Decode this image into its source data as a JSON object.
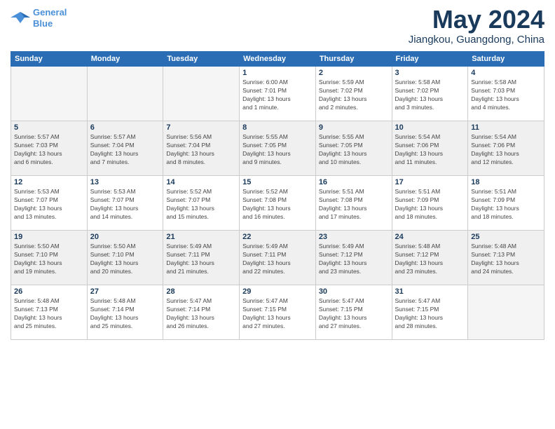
{
  "logo": {
    "line1": "General",
    "line2": "Blue"
  },
  "title": "May 2024",
  "location": "Jiangkou, Guangdong, China",
  "days_of_week": [
    "Sunday",
    "Monday",
    "Tuesday",
    "Wednesday",
    "Thursday",
    "Friday",
    "Saturday"
  ],
  "weeks": [
    [
      {
        "day": "",
        "info": ""
      },
      {
        "day": "",
        "info": ""
      },
      {
        "day": "",
        "info": ""
      },
      {
        "day": "1",
        "info": "Sunrise: 6:00 AM\nSunset: 7:01 PM\nDaylight: 13 hours\nand 1 minute."
      },
      {
        "day": "2",
        "info": "Sunrise: 5:59 AM\nSunset: 7:02 PM\nDaylight: 13 hours\nand 2 minutes."
      },
      {
        "day": "3",
        "info": "Sunrise: 5:58 AM\nSunset: 7:02 PM\nDaylight: 13 hours\nand 3 minutes."
      },
      {
        "day": "4",
        "info": "Sunrise: 5:58 AM\nSunset: 7:03 PM\nDaylight: 13 hours\nand 4 minutes."
      }
    ],
    [
      {
        "day": "5",
        "info": "Sunrise: 5:57 AM\nSunset: 7:03 PM\nDaylight: 13 hours\nand 6 minutes."
      },
      {
        "day": "6",
        "info": "Sunrise: 5:57 AM\nSunset: 7:04 PM\nDaylight: 13 hours\nand 7 minutes."
      },
      {
        "day": "7",
        "info": "Sunrise: 5:56 AM\nSunset: 7:04 PM\nDaylight: 13 hours\nand 8 minutes."
      },
      {
        "day": "8",
        "info": "Sunrise: 5:55 AM\nSunset: 7:05 PM\nDaylight: 13 hours\nand 9 minutes."
      },
      {
        "day": "9",
        "info": "Sunrise: 5:55 AM\nSunset: 7:05 PM\nDaylight: 13 hours\nand 10 minutes."
      },
      {
        "day": "10",
        "info": "Sunrise: 5:54 AM\nSunset: 7:06 PM\nDaylight: 13 hours\nand 11 minutes."
      },
      {
        "day": "11",
        "info": "Sunrise: 5:54 AM\nSunset: 7:06 PM\nDaylight: 13 hours\nand 12 minutes."
      }
    ],
    [
      {
        "day": "12",
        "info": "Sunrise: 5:53 AM\nSunset: 7:07 PM\nDaylight: 13 hours\nand 13 minutes."
      },
      {
        "day": "13",
        "info": "Sunrise: 5:53 AM\nSunset: 7:07 PM\nDaylight: 13 hours\nand 14 minutes."
      },
      {
        "day": "14",
        "info": "Sunrise: 5:52 AM\nSunset: 7:07 PM\nDaylight: 13 hours\nand 15 minutes."
      },
      {
        "day": "15",
        "info": "Sunrise: 5:52 AM\nSunset: 7:08 PM\nDaylight: 13 hours\nand 16 minutes."
      },
      {
        "day": "16",
        "info": "Sunrise: 5:51 AM\nSunset: 7:08 PM\nDaylight: 13 hours\nand 17 minutes."
      },
      {
        "day": "17",
        "info": "Sunrise: 5:51 AM\nSunset: 7:09 PM\nDaylight: 13 hours\nand 18 minutes."
      },
      {
        "day": "18",
        "info": "Sunrise: 5:51 AM\nSunset: 7:09 PM\nDaylight: 13 hours\nand 18 minutes."
      }
    ],
    [
      {
        "day": "19",
        "info": "Sunrise: 5:50 AM\nSunset: 7:10 PM\nDaylight: 13 hours\nand 19 minutes."
      },
      {
        "day": "20",
        "info": "Sunrise: 5:50 AM\nSunset: 7:10 PM\nDaylight: 13 hours\nand 20 minutes."
      },
      {
        "day": "21",
        "info": "Sunrise: 5:49 AM\nSunset: 7:11 PM\nDaylight: 13 hours\nand 21 minutes."
      },
      {
        "day": "22",
        "info": "Sunrise: 5:49 AM\nSunset: 7:11 PM\nDaylight: 13 hours\nand 22 minutes."
      },
      {
        "day": "23",
        "info": "Sunrise: 5:49 AM\nSunset: 7:12 PM\nDaylight: 13 hours\nand 23 minutes."
      },
      {
        "day": "24",
        "info": "Sunrise: 5:48 AM\nSunset: 7:12 PM\nDaylight: 13 hours\nand 23 minutes."
      },
      {
        "day": "25",
        "info": "Sunrise: 5:48 AM\nSunset: 7:13 PM\nDaylight: 13 hours\nand 24 minutes."
      }
    ],
    [
      {
        "day": "26",
        "info": "Sunrise: 5:48 AM\nSunset: 7:13 PM\nDaylight: 13 hours\nand 25 minutes."
      },
      {
        "day": "27",
        "info": "Sunrise: 5:48 AM\nSunset: 7:14 PM\nDaylight: 13 hours\nand 25 minutes."
      },
      {
        "day": "28",
        "info": "Sunrise: 5:47 AM\nSunset: 7:14 PM\nDaylight: 13 hours\nand 26 minutes."
      },
      {
        "day": "29",
        "info": "Sunrise: 5:47 AM\nSunset: 7:15 PM\nDaylight: 13 hours\nand 27 minutes."
      },
      {
        "day": "30",
        "info": "Sunrise: 5:47 AM\nSunset: 7:15 PM\nDaylight: 13 hours\nand 27 minutes."
      },
      {
        "day": "31",
        "info": "Sunrise: 5:47 AM\nSunset: 7:15 PM\nDaylight: 13 hours\nand 28 minutes."
      },
      {
        "day": "",
        "info": ""
      }
    ]
  ]
}
